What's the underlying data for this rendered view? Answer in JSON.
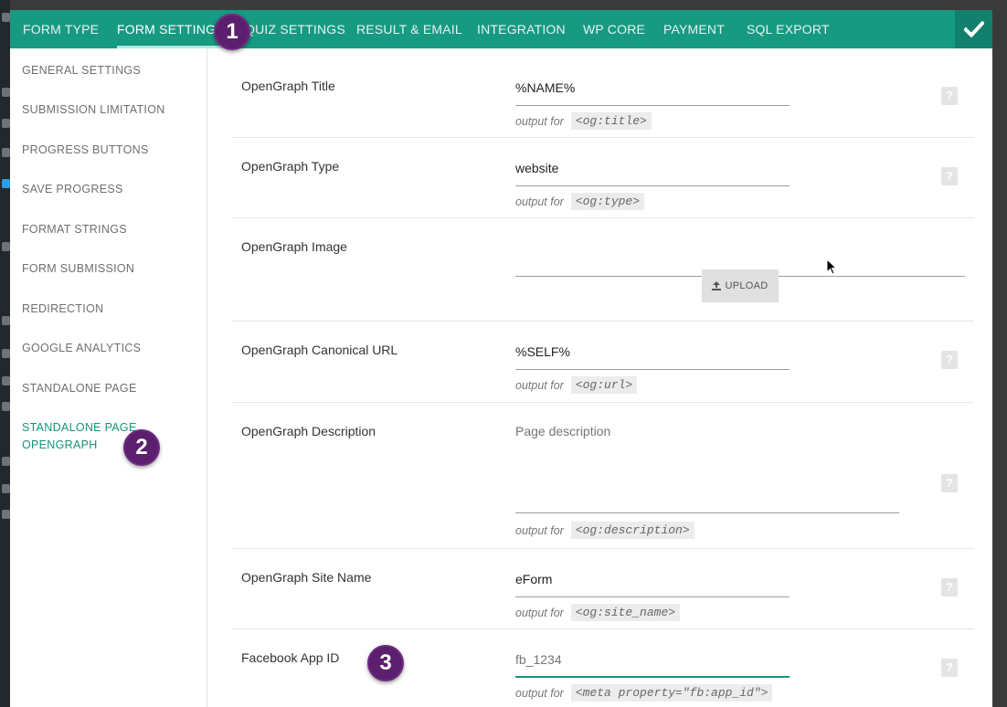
{
  "tabs": [
    {
      "label": "FORM TYPE"
    },
    {
      "label": "FORM SETTINGS"
    },
    {
      "label": "QUIZ SETTINGS"
    },
    {
      "label": "RESULT & EMAIL"
    },
    {
      "label": "INTEGRATION"
    },
    {
      "label": "WP CORE"
    },
    {
      "label": "PAYMENT"
    },
    {
      "label": "SQL EXPORT"
    }
  ],
  "active_tab": "FORM SETTINGS",
  "sidebar": {
    "items": [
      {
        "label": "GENERAL SETTINGS"
      },
      {
        "label": "SUBMISSION LIMITATION"
      },
      {
        "label": "PROGRESS BUTTONS"
      },
      {
        "label": "SAVE PROGRESS"
      },
      {
        "label": "FORMAT STRINGS"
      },
      {
        "label": "FORM SUBMISSION"
      },
      {
        "label": "REDIRECTION"
      },
      {
        "label": "GOOGLE ANALYTICS"
      },
      {
        "label": "STANDALONE PAGE"
      },
      {
        "label": "STANDALONE PAGE OPENGRAPH"
      }
    ],
    "active": "STANDALONE PAGE OPENGRAPH"
  },
  "fields": {
    "og_title": {
      "label": "OpenGraph Title",
      "value": "%NAME%",
      "hint_prefix": "output for",
      "hint_code": "<og:title>"
    },
    "og_type": {
      "label": "OpenGraph Type",
      "value": "website",
      "hint_prefix": "output for",
      "hint_code": "<og:type>"
    },
    "og_image": {
      "label": "OpenGraph Image",
      "value": "",
      "upload_label": "UPLOAD"
    },
    "og_url": {
      "label": "OpenGraph Canonical URL",
      "value": "%SELF%",
      "hint_prefix": "output for",
      "hint_code": "<og:url>"
    },
    "og_description": {
      "label": "OpenGraph Description",
      "placeholder": "Page description",
      "hint_prefix": "output for",
      "hint_code": "<og:description>"
    },
    "og_site_name": {
      "label": "OpenGraph Site Name",
      "value": "eForm",
      "hint_prefix": "output for",
      "hint_code": "<og:site_name>"
    },
    "fb_app_id": {
      "label": "Facebook App ID",
      "placeholder": "fb_1234",
      "hint_prefix": "output for",
      "hint_code": "<meta property=\"fb:app_id\">"
    }
  },
  "help_glyph": "?",
  "badges": {
    "one": "1",
    "two": "2",
    "three": "3"
  },
  "colors": {
    "accent": "#179a82",
    "badge": "#5b1f6e"
  },
  "icons": {
    "save": "check-icon",
    "upload": "upload-icon",
    "help": "help-icon"
  }
}
